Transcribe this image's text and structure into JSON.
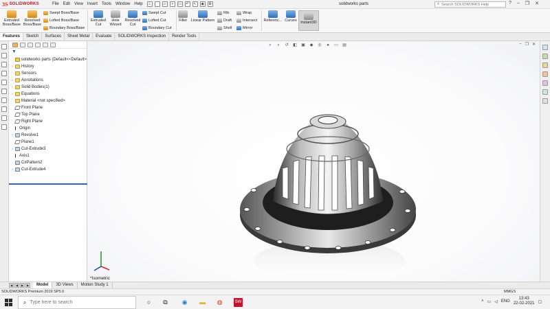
{
  "app": {
    "brand": "SOLIDWORKS",
    "menus": [
      "File",
      "Edit",
      "View",
      "Insert",
      "Tools",
      "Window",
      "Help"
    ],
    "doc_title": "solidworks parts",
    "search_placeholder": "Search SOLIDWORKS Help"
  },
  "ribbon": {
    "extruded_boss": "Extruded Boss/Base",
    "revolved_boss": "Revolved Boss/Base",
    "swept_boss": "Swept Boss/Base",
    "lofted_boss": "Lofted Boss/Base",
    "boundary_boss": "Boundary Boss/Base",
    "extruded_cut": "Extruded Cut",
    "hole_wizard": "Hole Wizard",
    "revolved_cut": "Revolved Cut",
    "swept_cut": "Swept Cut",
    "lofted_cut": "Lofted Cut",
    "boundary_cut": "Boundary Cut",
    "fillet": "Fillet",
    "linear_pattern": "Linear Pattern",
    "rib": "Rib",
    "draft": "Draft",
    "shell": "Shell",
    "wrap": "Wrap",
    "intersect": "Intersect",
    "mirror": "Mirror",
    "reference": "Referenc...",
    "curves": "Curves",
    "instant3d": "Instant3D"
  },
  "tabs": [
    "Features",
    "Sketch",
    "Surfaces",
    "Sheet Metal",
    "Evaluate",
    "SOLIDWORKS Inspection",
    "Render Tools"
  ],
  "tree": [
    {
      "label": "solidworks parts  (Default<<Default>",
      "icon": "part",
      "arrow": ""
    },
    {
      "label": "History",
      "icon": "folder",
      "arrow": "›"
    },
    {
      "label": "Sensors",
      "icon": "folder",
      "arrow": ""
    },
    {
      "label": "Annotations",
      "icon": "folder",
      "arrow": "›"
    },
    {
      "label": "Solid Bodies(1)",
      "icon": "folder",
      "arrow": "›"
    },
    {
      "label": "Equations",
      "icon": "folder",
      "arrow": "›"
    },
    {
      "label": "Material <not specified>",
      "icon": "folder",
      "arrow": ""
    },
    {
      "label": "Front Plane",
      "icon": "plane",
      "arrow": ""
    },
    {
      "label": "Top Plane",
      "icon": "plane",
      "arrow": ""
    },
    {
      "label": "Right Plane",
      "icon": "plane",
      "arrow": ""
    },
    {
      "label": "Origin",
      "icon": "axis",
      "arrow": ""
    },
    {
      "label": "Revolve1",
      "icon": "feat",
      "arrow": "›"
    },
    {
      "label": "Plane1",
      "icon": "plane",
      "arrow": ""
    },
    {
      "label": "Cut-Extrude3",
      "icon": "feat",
      "arrow": "›"
    },
    {
      "label": "Axis1",
      "icon": "axis",
      "arrow": ""
    },
    {
      "label": "CirPattern2",
      "icon": "feat",
      "arrow": ""
    },
    {
      "label": "Cut-Extrude4",
      "icon": "feat",
      "arrow": "›"
    }
  ],
  "viewport": {
    "view_label": "*Isometric"
  },
  "bottom_tabs": [
    "Model",
    "3D Views",
    "Motion Study 1"
  ],
  "status": {
    "left": "SOLIDWORKS Premium 2019 SP5.0",
    "units": "MMGS"
  },
  "taskbar": {
    "search_placeholder": "Type here to search",
    "lang": "ENG",
    "time": "13:43",
    "date": "22-02-2021"
  },
  "colors": {
    "accent": "#2a64b8",
    "brand": "#c8102e"
  }
}
